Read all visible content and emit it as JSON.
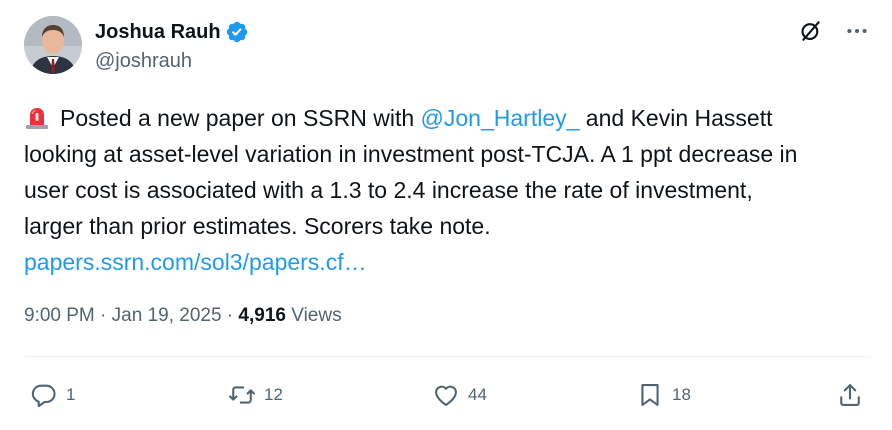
{
  "author": {
    "display_name": "Joshua Rauh",
    "handle": "@joshrauh"
  },
  "tweet": {
    "emoji": "rotating-light",
    "text_part1": "Posted a new paper on SSRN with ",
    "mention": "@Jon_Hartley_",
    "text_part2": " and Kevin Hassett",
    "line2": "looking at asset-level variation in investment post-TCJA. A 1 ppt decrease in",
    "line3": "user cost is associated with a 1.3 to 2.4 increase the rate of investment,",
    "line4": "larger than prior estimates. Scorers take note.",
    "link": "papers.ssrn.com/sol3/papers.cf…"
  },
  "meta": {
    "time": "9:00 PM",
    "separator": " · ",
    "date": "Jan 19, 2025",
    "views_count": "4,916",
    "views_label": " Views"
  },
  "actions": {
    "replies": "1",
    "reposts": "12",
    "likes": "44",
    "bookmarks": "18"
  },
  "colors": {
    "link": "#1d9bf0",
    "text": "#0f1419",
    "secondary": "#536471",
    "verified": "#1d9bf0"
  }
}
